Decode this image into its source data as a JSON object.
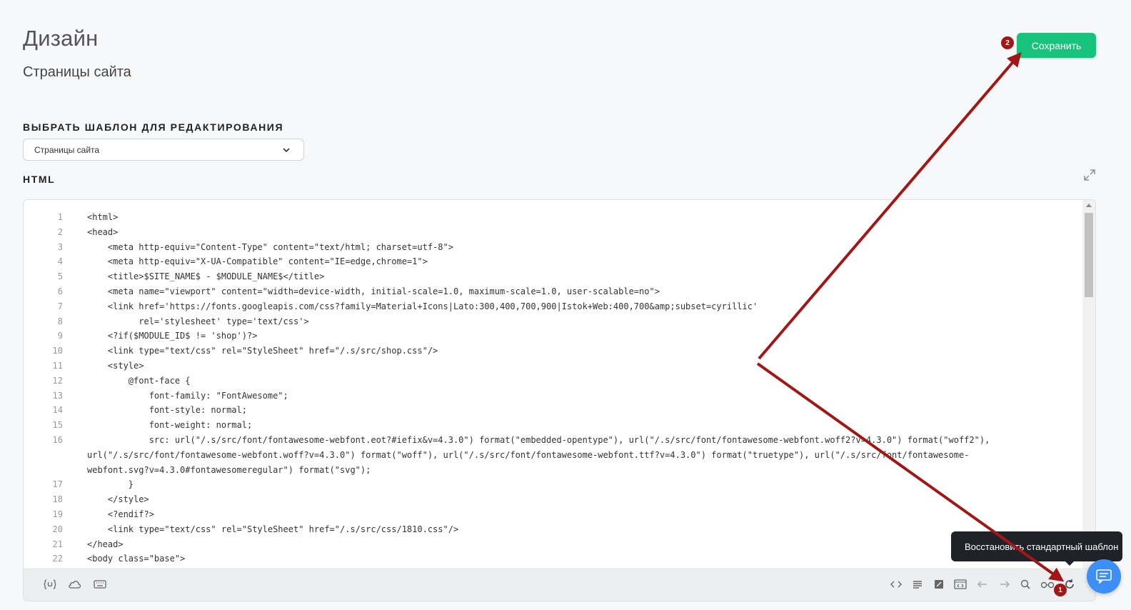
{
  "page": {
    "title": "Дизайн",
    "subtitle": "Страницы сайта"
  },
  "actions": {
    "save_label": "Сохранить"
  },
  "annotations": {
    "badge_1": "1",
    "badge_2": "2"
  },
  "template_select": {
    "section_label": "ВЫБРАТЬ ШАБЛОН ДЛЯ РЕДАКТИРОВАНИЯ",
    "value": "Страницы сайта"
  },
  "editor": {
    "label": "HTML",
    "lines": [
      {
        "n": "1",
        "text": "<html>"
      },
      {
        "n": "2",
        "text": "<head>"
      },
      {
        "n": "3",
        "text": "    <meta http-equiv=\"Content-Type\" content=\"text/html; charset=utf-8\">"
      },
      {
        "n": "4",
        "text": "    <meta http-equiv=\"X-UA-Compatible\" content=\"IE=edge,chrome=1\">"
      },
      {
        "n": "5",
        "text": "    <title>$SITE_NAME$ - $MODULE_NAME$</title>"
      },
      {
        "n": "6",
        "text": "    <meta name=\"viewport\" content=\"width=device-width, initial-scale=1.0, maximum-scale=1.0, user-scalable=no\">"
      },
      {
        "n": "7",
        "text": "    <link href='https://fonts.googleapis.com/css?family=Material+Icons|Lato:300,400,700,900|Istok+Web:400,700&amp;subset=cyrillic'"
      },
      {
        "n": "8",
        "text": "          rel='stylesheet' type='text/css'>"
      },
      {
        "n": "9",
        "text": "    <?if($MODULE_ID$ != 'shop')?>"
      },
      {
        "n": "10",
        "text": "    <link type=\"text/css\" rel=\"StyleSheet\" href=\"/.s/src/shop.css\"/>"
      },
      {
        "n": "11",
        "text": "    <style>"
      },
      {
        "n": "12",
        "text": "        @font-face {"
      },
      {
        "n": "13",
        "text": "            font-family: \"FontAwesome\";"
      },
      {
        "n": "14",
        "text": "            font-style: normal;"
      },
      {
        "n": "15",
        "text": "            font-weight: normal;"
      },
      {
        "n": "16",
        "text": "            src: url(\"/.s/src/font/fontawesome-webfont.eot?#iefix&v=4.3.0\") format(\"embedded-opentype\"), url(\"/.s/src/font/fontawesome-webfont.woff2?v=4.3.0\") format(\"woff2\"),"
      },
      {
        "n": "",
        "text": "url(\"/.s/src/font/fontawesome-webfont.woff?v=4.3.0\") format(\"woff\"), url(\"/.s/src/font/fontawesome-webfont.ttf?v=4.3.0\") format(\"truetype\"), url(\"/.s/src/font/fontawesome-"
      },
      {
        "n": "",
        "text": "webfont.svg?v=4.3.0#fontawesomeregular\") format(\"svg\");"
      },
      {
        "n": "17",
        "text": "        }"
      },
      {
        "n": "18",
        "text": "    </style>"
      },
      {
        "n": "19",
        "text": "    <?endif?>"
      },
      {
        "n": "20",
        "text": "    <link type=\"text/css\" rel=\"StyleSheet\" href=\"/.s/src/css/1810.css\"/>"
      },
      {
        "n": "21",
        "text": "</head>"
      },
      {
        "n": "22",
        "text": "<body class=\"base\">"
      }
    ]
  },
  "toolbar": {
    "left_icons": [
      "template-variables-icon",
      "cloud-icon",
      "keyboard-icon"
    ],
    "right_icons": [
      "code-icon",
      "format-align-icon",
      "edit-square-icon",
      "code-window-icon",
      "undo-icon",
      "redo-icon",
      "search-icon",
      "glasses-icon",
      "restore-icon"
    ]
  },
  "tooltip": {
    "text": "Восстановить стандартный шаблон"
  },
  "colors": {
    "save_button": "#18c47c",
    "annotation_red": "#a31616",
    "chat_button": "#3e8ef7",
    "tooltip_bg": "#1f2328"
  }
}
